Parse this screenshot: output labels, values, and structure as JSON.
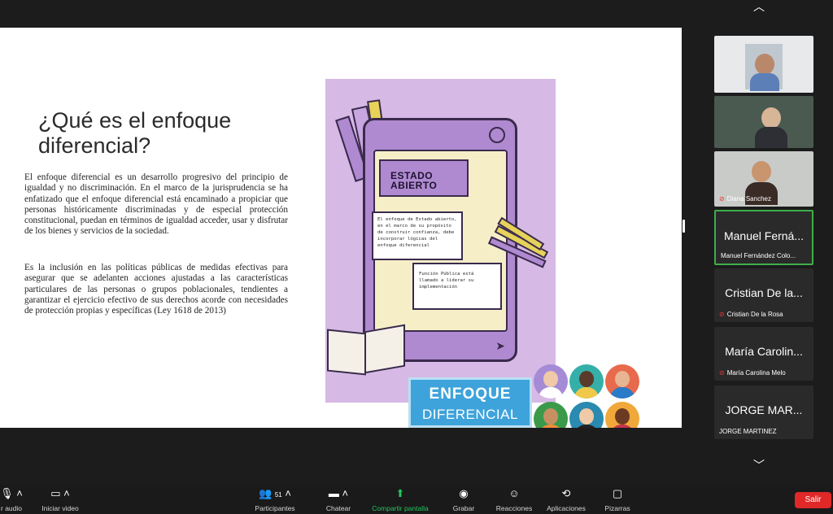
{
  "slide": {
    "title": "¿Qué es el enfoque diferencial?",
    "paragraph1": "El enfoque diferencial es un desarrollo progresivo del principio de igualdad y no discriminación. En el marco de la jurisprudencia se ha enfatizado que el enfoque diferencial está encaminado a propiciar que personas históricamente discriminadas y de especial protección constitucional, puedan en términos de igualdad acceder, usar y disfrutar de los bienes y servicios de la sociedad.",
    "paragraph2": "Es la inclusión en las políticas públicas de medidas efectivas para asegurar que se adelanten acciones ajustadas a las características particulares de las personas o grupos poblacionales, tendientes a garantizar el ejercicio efectivo de sus derechos acorde con necesidades de protección propias y específicas (Ley 1618 de 2013)",
    "illustration": {
      "bubble_title": "ESTADO ABIERTO",
      "bubble_a": "El enfoque de Estado abierto, en el marco de su propósito de construir confianza, debe incorporar lógicas del enfoque diferencial",
      "bubble_b": "Función Pública está llamado a liderar su implementación"
    },
    "banner": {
      "line1": "ENFOQUE",
      "line2": "DIFERENCIAL"
    }
  },
  "participants": [
    {
      "name": "",
      "caption": ""
    },
    {
      "name": "",
      "caption": ""
    },
    {
      "name": "",
      "caption": "Diana Sanchez"
    },
    {
      "name": "Manuel Ferná...",
      "caption": "Manuel Fernández Colo..."
    },
    {
      "name": "Cristian De la...",
      "caption": "Cristian De la Rosa"
    },
    {
      "name": "María Carolin...",
      "caption": "María Carolina Melo"
    },
    {
      "name": "JORGE MAR...",
      "caption": "JORGE MARTINEZ"
    }
  ],
  "toolbar": {
    "audio": "r audio",
    "video": "Iniciar video",
    "participants_count": "51",
    "participants": "Participantes",
    "chat": "Chatear",
    "share": "Compartir pantalla",
    "record": "Grabar",
    "reactions": "Reacciones",
    "apps": "Aplicaciones",
    "whiteboards": "Pizarras",
    "leave": "Salir"
  },
  "colors": {
    "share_green": "#22c55e",
    "leave_red": "#e02828",
    "banner_blue": "#3ea3db",
    "lilac": "#d6b9e4",
    "active_speaker": "#3fae49"
  },
  "icons": [
    "chevron-up-icon",
    "chevron-down-icon",
    "mic-off-icon",
    "video-off-icon",
    "participants-icon",
    "chat-icon",
    "share-screen-icon",
    "record-icon",
    "reactions-icon",
    "apps-icon",
    "whiteboard-icon"
  ]
}
